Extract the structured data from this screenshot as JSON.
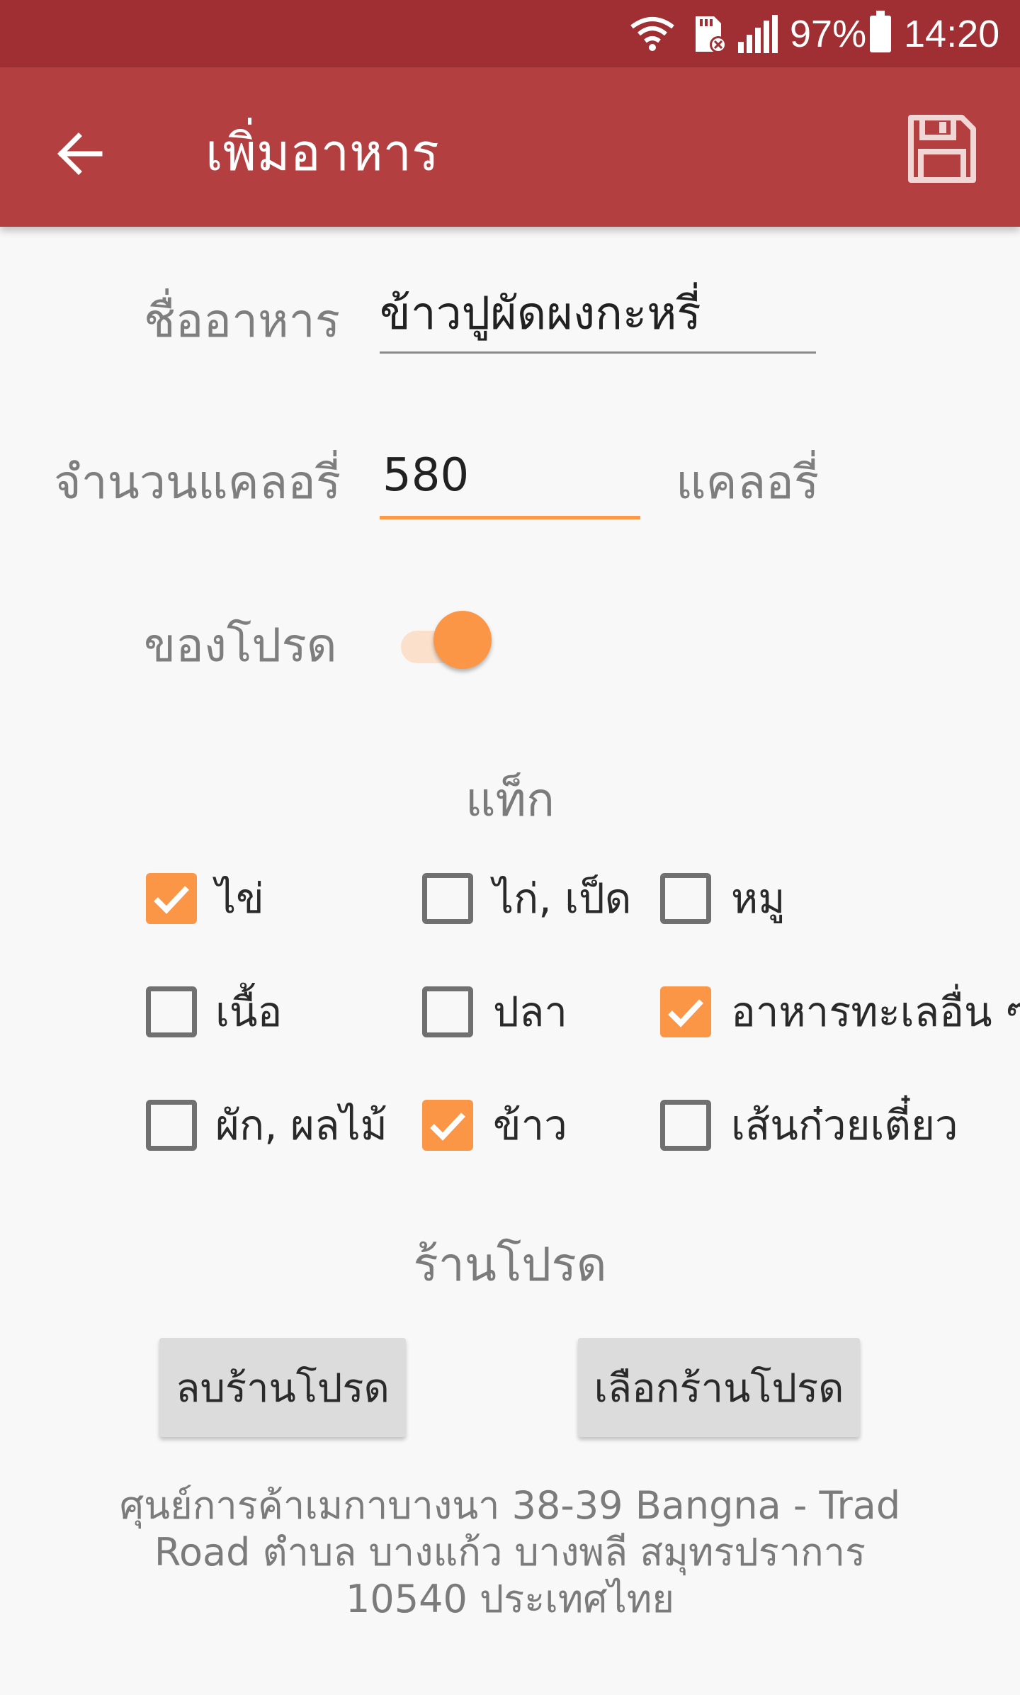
{
  "status_bar": {
    "battery_percent": "97%",
    "time": "14:20"
  },
  "app_bar": {
    "title": "เพิ่มอาหาร",
    "icons": {
      "back": "arrow-back-icon",
      "save": "save-floppy-icon"
    }
  },
  "form": {
    "food_name_label": "ชื่ออาหาร",
    "food_name_value": "ข้าวปูผัดผงกะหรี่",
    "calories_label": "จำนวนแคลอรี่",
    "calories_value": "580",
    "calories_unit": "แคลอรี่",
    "favorite_label": "ของโปรด",
    "favorite_on": true
  },
  "tags": {
    "title": "แท็ก",
    "items": [
      {
        "label": "ไข่",
        "checked": true
      },
      {
        "label": "ไก่, เป็ด",
        "checked": false
      },
      {
        "label": "หมู",
        "checked": false
      },
      {
        "label": "เนื้อ",
        "checked": false
      },
      {
        "label": "ปลา",
        "checked": false
      },
      {
        "label": "อาหารทะเลอื่น ๆ",
        "checked": true
      },
      {
        "label": "ผัก, ผลไม้",
        "checked": false
      },
      {
        "label": "ข้าว",
        "checked": true
      },
      {
        "label": "เส้นก๋วยเตี๋ยว",
        "checked": false
      }
    ]
  },
  "favorite_shop": {
    "title": "ร้านโปรด",
    "remove_button": "ลบร้านโปรด",
    "choose_button": "เลือกร้านโปรด",
    "address_line1": "ศุนย์การค้าเมกาบางนา 38-39 Bangna - Trad",
    "address_line2": "Road ตำบล บางแก้ว บางพลี สมุทรปราการ",
    "address_line3": "10540 ประเทศไทย"
  },
  "colors": {
    "status_bar": "#9f2f32",
    "app_bar": "#b43f41",
    "accent": "#fb9646",
    "background": "#f8f8f8"
  }
}
